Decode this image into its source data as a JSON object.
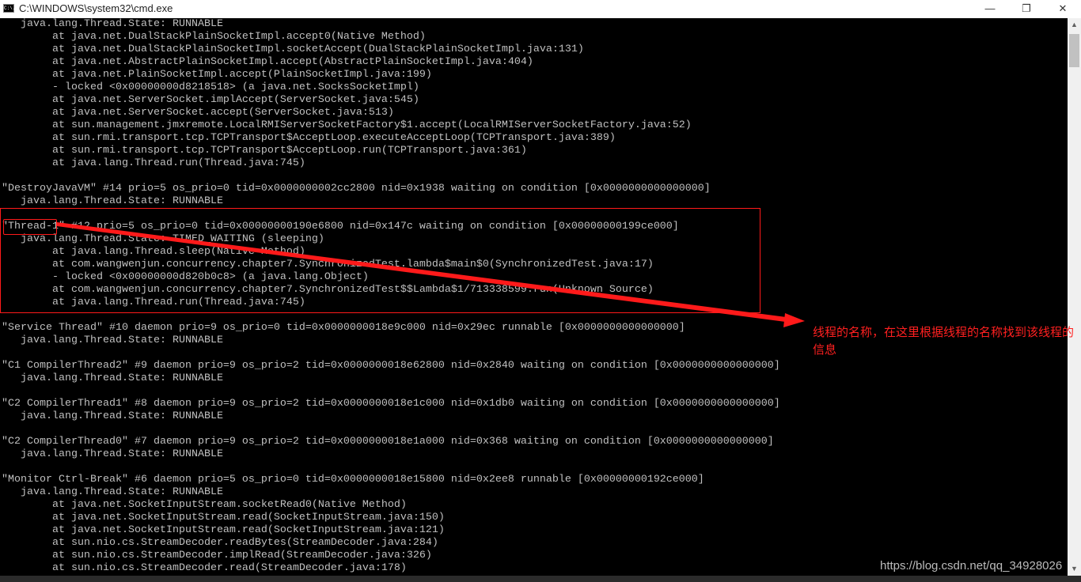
{
  "window": {
    "title": "C:\\WINDOWS\\system32\\cmd.exe",
    "icon_label": "C:\\.",
    "minimize_icon": "minimize-icon",
    "maximize_icon": "restore-icon",
    "close_icon": "close-icon"
  },
  "console_lines": [
    "   java.lang.Thread.State: RUNNABLE",
    "        at java.net.DualStackPlainSocketImpl.accept0(Native Method)",
    "        at java.net.DualStackPlainSocketImpl.socketAccept(DualStackPlainSocketImpl.java:131)",
    "        at java.net.AbstractPlainSocketImpl.accept(AbstractPlainSocketImpl.java:404)",
    "        at java.net.PlainSocketImpl.accept(PlainSocketImpl.java:199)",
    "        - locked <0x00000000d8218518> (a java.net.SocksSocketImpl)",
    "        at java.net.ServerSocket.implAccept(ServerSocket.java:545)",
    "        at java.net.ServerSocket.accept(ServerSocket.java:513)",
    "        at sun.management.jmxremote.LocalRMIServerSocketFactory$1.accept(LocalRMIServerSocketFactory.java:52)",
    "        at sun.rmi.transport.tcp.TCPTransport$AcceptLoop.executeAcceptLoop(TCPTransport.java:389)",
    "        at sun.rmi.transport.tcp.TCPTransport$AcceptLoop.run(TCPTransport.java:361)",
    "        at java.lang.Thread.run(Thread.java:745)",
    "",
    "\"DestroyJavaVM\" #14 prio=5 os_prio=0 tid=0x0000000002cc2800 nid=0x1938 waiting on condition [0x0000000000000000]",
    "   java.lang.Thread.State: RUNNABLE",
    "",
    "\"Thread-1\" #12 prio=5 os_prio=0 tid=0x00000000190e6800 nid=0x147c waiting on condition [0x00000000199ce000]",
    "   java.lang.Thread.State: TIMED_WAITING (sleeping)",
    "        at java.lang.Thread.sleep(Native Method)",
    "        at com.wangwenjun.concurrency.chapter7.SynchronizedTest.lambda$main$0(SynchronizedTest.java:17)",
    "        - locked <0x00000000d820b0c8> (a java.lang.Object)",
    "        at com.wangwenjun.concurrency.chapter7.SynchronizedTest$$Lambda$1/713338599.run(Unknown Source)",
    "        at java.lang.Thread.run(Thread.java:745)",
    "",
    "\"Service Thread\" #10 daemon prio=9 os_prio=0 tid=0x0000000018e9c000 nid=0x29ec runnable [0x0000000000000000]",
    "   java.lang.Thread.State: RUNNABLE",
    "",
    "\"C1 CompilerThread2\" #9 daemon prio=9 os_prio=2 tid=0x0000000018e62800 nid=0x2840 waiting on condition [0x0000000000000000]",
    "   java.lang.Thread.State: RUNNABLE",
    "",
    "\"C2 CompilerThread1\" #8 daemon prio=9 os_prio=2 tid=0x0000000018e1c000 nid=0x1db0 waiting on condition [0x0000000000000000]",
    "   java.lang.Thread.State: RUNNABLE",
    "",
    "\"C2 CompilerThread0\" #7 daemon prio=9 os_prio=2 tid=0x0000000018e1a000 nid=0x368 waiting on condition [0x0000000000000000]",
    "   java.lang.Thread.State: RUNNABLE",
    "",
    "\"Monitor Ctrl-Break\" #6 daemon prio=5 os_prio=0 tid=0x0000000018e15800 nid=0x2ee8 runnable [0x00000000192ce000]",
    "   java.lang.Thread.State: RUNNABLE",
    "        at java.net.SocketInputStream.socketRead0(Native Method)",
    "        at java.net.SocketInputStream.read(SocketInputStream.java:150)",
    "        at java.net.SocketInputStream.read(SocketInputStream.java:121)",
    "        at sun.nio.cs.StreamDecoder.readBytes(StreamDecoder.java:284)",
    "        at sun.nio.cs.StreamDecoder.implRead(StreamDecoder.java:326)",
    "        at sun.nio.cs.StreamDecoder.read(StreamDecoder.java:178)"
  ],
  "annotation": {
    "text": "线程的名称，在这里根据线程的名称找到该线程的信息",
    "color": "#ff2020"
  },
  "watermark": "https://blog.csdn.net/qq_34928026",
  "colors": {
    "console_bg": "#000000",
    "console_fg": "#c0c0c0",
    "annotation": "#ff1a1a"
  }
}
